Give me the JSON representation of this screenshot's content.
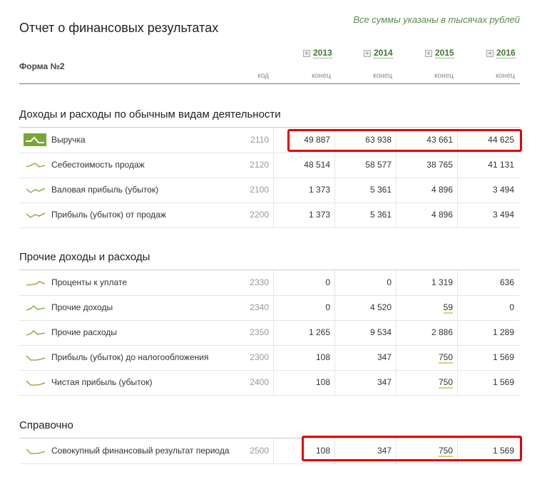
{
  "header": {
    "note": "Все суммы указаны в тысячах рублей",
    "title": "Отчет о финансовых результатах",
    "form": "Форма №2",
    "code_label": "код",
    "years": [
      "2013",
      "2014",
      "2015",
      "2016"
    ],
    "konec": "конец",
    "expand_glyph": "+"
  },
  "sections": [
    {
      "title": "Доходы и расходы по обычным видам деятельности",
      "rows": [
        {
          "name": "Выручка",
          "code": "2110",
          "values": [
            "49 887",
            "63 938",
            "43 661",
            "44 625"
          ]
        },
        {
          "name": "Себестоимость продаж",
          "code": "2120",
          "values": [
            "48 514",
            "58 577",
            "38 765",
            "41 131"
          ]
        },
        {
          "name": "Валовая прибыль (убыток)",
          "code": "2100",
          "values": [
            "1 373",
            "5 361",
            "4 896",
            "3 494"
          ]
        },
        {
          "name": "Прибыль (убыток) от продаж",
          "code": "2200",
          "values": [
            "1 373",
            "5 361",
            "4 896",
            "3 494"
          ]
        }
      ]
    },
    {
      "title": "Прочие доходы и расходы",
      "rows": [
        {
          "name": "Проценты к уплате",
          "code": "2330",
          "values": [
            "0",
            "0",
            "1 319",
            "636"
          ]
        },
        {
          "name": "Прочие доходы",
          "code": "2340",
          "values": [
            "0",
            "4 520",
            "59",
            "0"
          ]
        },
        {
          "name": "Прочие расходы",
          "code": "2350",
          "values": [
            "1 265",
            "9 534",
            "2 886",
            "1 289"
          ]
        },
        {
          "name": "Прибыль (убыток) до налогообложения",
          "code": "2300",
          "values": [
            "108",
            "347",
            "750",
            "1 569"
          ]
        },
        {
          "name": "Чистая прибыль (убыток)",
          "code": "2400",
          "values": [
            "108",
            "347",
            "750",
            "1 569"
          ]
        }
      ]
    },
    {
      "title": "Справочно",
      "rows": [
        {
          "name": "Совокупный финансовый результат периода",
          "code": "2500",
          "values": [
            "108",
            "347",
            "750",
            "1 569"
          ]
        }
      ]
    }
  ],
  "colors": {
    "accent": "#3d7a30",
    "spark": "#7aa635",
    "highlight": "#e0000b"
  }
}
